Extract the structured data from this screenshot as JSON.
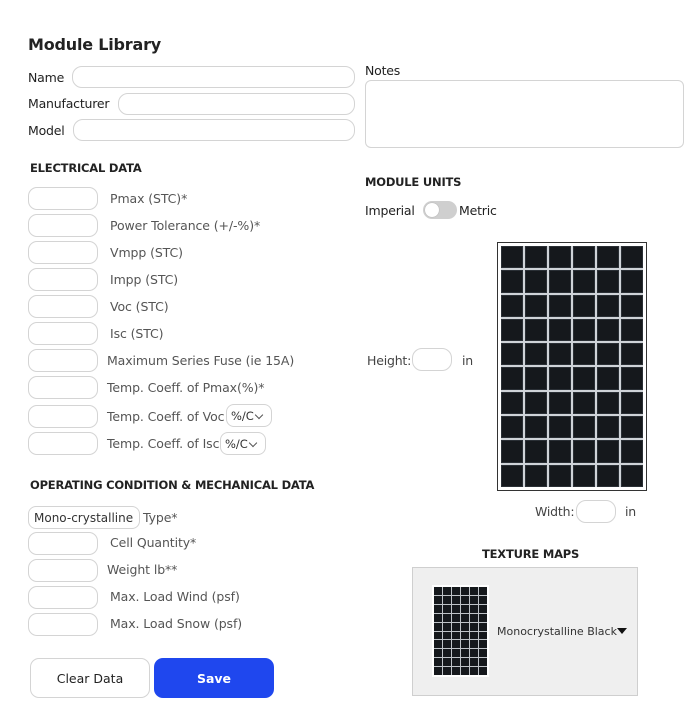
{
  "page_title": "Module Library",
  "identity": {
    "name_label": "Name",
    "manufacturer_label": "Manufacturer",
    "model_label": "Model",
    "name_value": "",
    "manufacturer_value": "",
    "model_value": ""
  },
  "notes": {
    "label": "Notes",
    "value": ""
  },
  "electrical": {
    "heading": "ELECTRICAL DATA",
    "fields": [
      {
        "label": "Pmax (STC)*",
        "value": ""
      },
      {
        "label": "Power Tolerance (+/-%)*",
        "value": ""
      },
      {
        "label": "Vmpp (STC)",
        "value": ""
      },
      {
        "label": "Impp (STC)",
        "value": ""
      },
      {
        "label": "Voc (STC)",
        "value": ""
      },
      {
        "label": "Isc (STC)",
        "value": ""
      },
      {
        "label": "Maximum Series Fuse (ie 15A)",
        "value": ""
      },
      {
        "label": "Temp. Coeff. of Pmax(%)*",
        "value": ""
      },
      {
        "label": "Temp. Coeff. of Voc",
        "value": "",
        "unit": "%/C"
      },
      {
        "label": "Temp. Coeff. of Isc",
        "value": "",
        "unit": "%/C"
      }
    ]
  },
  "mechanical": {
    "heading": "OPERATING CONDITION & MECHANICAL DATA",
    "type_value": "Mono-crystalline",
    "type_label": "Type*",
    "fields": [
      {
        "label": "Cell Quantity*",
        "value": ""
      },
      {
        "label": "Weight  lb**",
        "value": ""
      },
      {
        "label": "Max. Load Wind (psf)",
        "value": ""
      },
      {
        "label": "Max. Load Snow (psf)",
        "value": ""
      }
    ]
  },
  "module_units": {
    "heading": "MODULE UNITS",
    "left_option": "Imperial",
    "right_option": "Metric",
    "height_label": "Height:",
    "height_unit": "in",
    "width_label": "Width:",
    "width_unit": "in"
  },
  "texture_maps": {
    "heading": "TEXTURE MAPS",
    "selected": "Monocrystalline Black"
  },
  "actions": {
    "clear_label": "Clear Data",
    "save_label": "Save"
  },
  "colors": {
    "accent": "#1f47ee",
    "panel_cell": "#15181c"
  }
}
